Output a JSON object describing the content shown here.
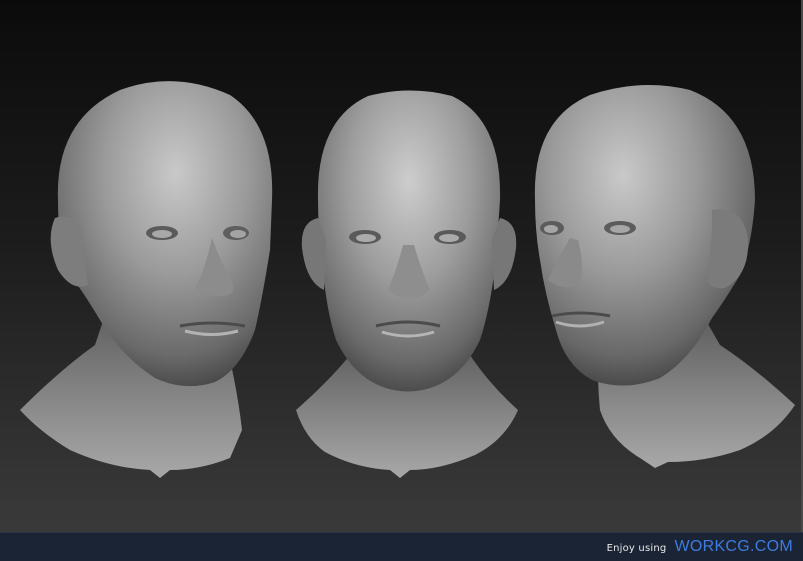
{
  "footer": {
    "prefix": "Enjoy using",
    "brand": "WORKCG.COM"
  },
  "colors": {
    "brand": "#3d7ce0",
    "footer_bg": "#1b2434",
    "clay": "#8a8a8a"
  },
  "viewport": {
    "subject": "three sculpted male head models"
  }
}
